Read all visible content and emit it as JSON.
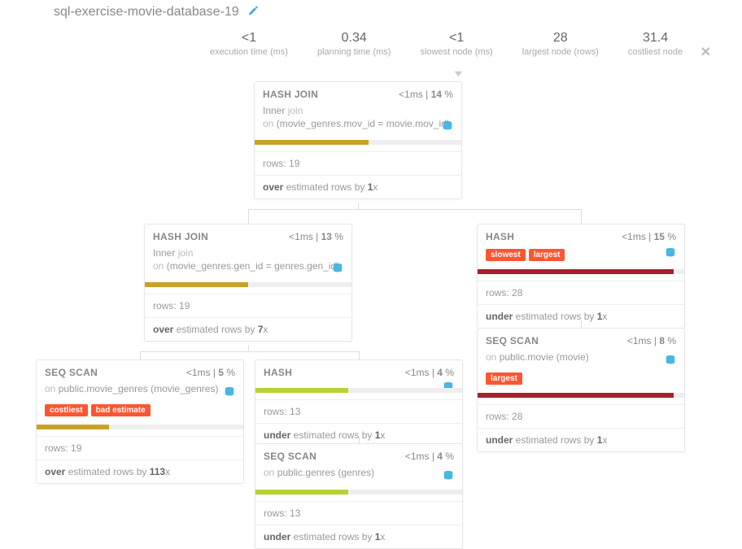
{
  "title": "sql-exercise-movie-database-19",
  "stats": [
    {
      "value": "<1",
      "label": "execution time (ms)"
    },
    {
      "value": "0.34",
      "label": "planning time (ms)"
    },
    {
      "value": "<1",
      "label": "slowest node (ms)"
    },
    {
      "value": "28",
      "label": "largest node (rows)"
    },
    {
      "value": "31.4",
      "label": "costliest node"
    }
  ],
  "nodes": {
    "n1": {
      "op": "HASH JOIN",
      "time": "<1",
      "pct": "14",
      "desc_kind": "Inner",
      "desc_word": "join",
      "desc_on_pre": "on",
      "desc_on": "(movie_genres.mov_id = movie.mov_id)",
      "bar_color": "olive",
      "bar_pct": 55,
      "rows": "19",
      "est_dir": "over",
      "est_factor": "1"
    },
    "n2": {
      "op": "HASH JOIN",
      "time": "<1",
      "pct": "13",
      "desc_kind": "Inner",
      "desc_word": "join",
      "desc_on_pre": "on",
      "desc_on": "(movie_genres.gen_id = genres.gen_id)",
      "bar_color": "olive",
      "bar_pct": 50,
      "rows": "19",
      "est_dir": "over",
      "est_factor": "7"
    },
    "n3": {
      "op": "HASH",
      "time": "<1",
      "pct": "15",
      "badges": [
        "slowest",
        "largest"
      ],
      "bar_color": "red",
      "bar_pct": 95,
      "rows": "28",
      "est_dir": "under",
      "est_factor": "1"
    },
    "n4": {
      "op": "SEQ SCAN",
      "time": "<1",
      "pct": "8",
      "desc_on_pre": "on",
      "desc_on": "public.movie (movie)",
      "badges": [
        "largest"
      ],
      "bar_color": "red",
      "bar_pct": 95,
      "rows": "28",
      "est_dir": "under",
      "est_factor": "1"
    },
    "n5": {
      "op": "SEQ SCAN",
      "time": "<1",
      "pct": "5",
      "desc_on_pre": "on",
      "desc_on": "public.movie_genres (movie_genres)",
      "badges": [
        "costliest",
        "bad estimate"
      ],
      "bar_color": "olive",
      "bar_pct": 35,
      "rows": "19",
      "est_dir": "over",
      "est_factor": "113"
    },
    "n6": {
      "op": "HASH",
      "time": "<1",
      "pct": "4",
      "bar_color": "lime",
      "bar_pct": 45,
      "rows": "13",
      "est_dir": "under",
      "est_factor": "1"
    },
    "n7": {
      "op": "SEQ SCAN",
      "time": "<1",
      "pct": "4",
      "desc_on_pre": "on",
      "desc_on": "public.genres (genres)",
      "bar_color": "lime",
      "bar_pct": 45,
      "rows": "13",
      "est_dir": "under",
      "est_factor": "1"
    }
  },
  "ui_text": {
    "ms_suffix": "ms",
    "pct_suffix": " %",
    "rows_label": "rows: ",
    "est_mid": " estimated rows by ",
    "est_suffix": "x"
  }
}
